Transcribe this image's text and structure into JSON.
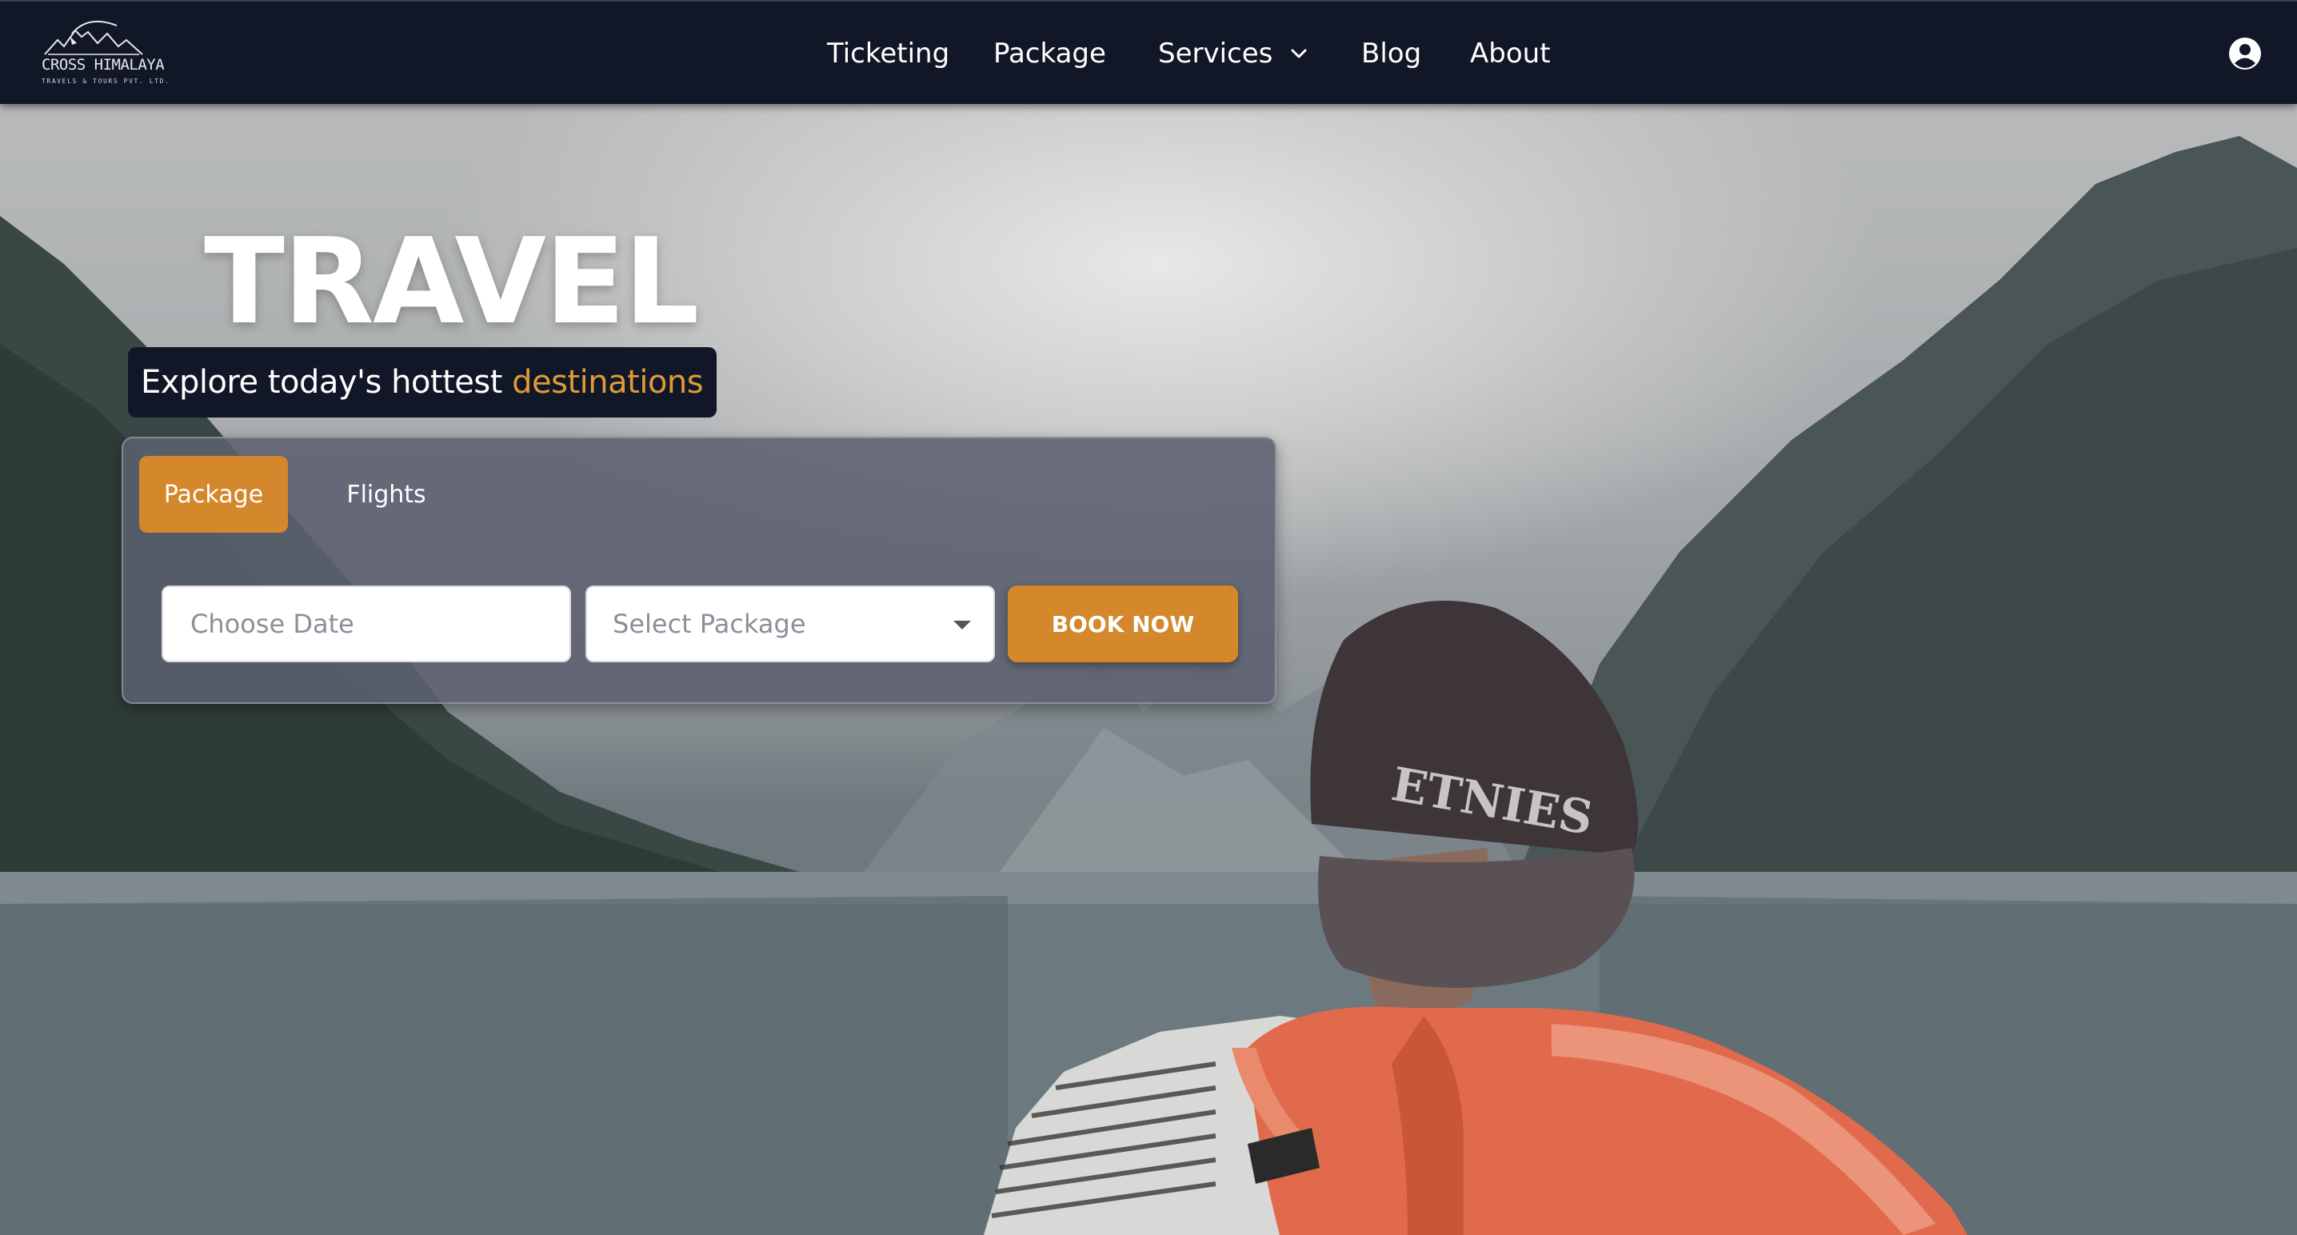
{
  "brand": {
    "name": "CROSS HIMALAYA",
    "subtitle": "TRAVELS & TOURS PVT. LTD."
  },
  "nav": {
    "items": [
      {
        "label": "Ticketing"
      },
      {
        "label": "Package"
      },
      {
        "label": "Services",
        "has_dropdown": true
      },
      {
        "label": "Blog"
      },
      {
        "label": "About"
      }
    ],
    "icons": [
      "chevron-down-icon",
      "user-account-icon"
    ]
  },
  "hero": {
    "headline": "TRAVEL",
    "tagline_prefix": "Explore today's hottest ",
    "tagline_accent": "destinations"
  },
  "booking": {
    "tabs": [
      {
        "label": "Package",
        "active": true
      },
      {
        "label": "Flights",
        "active": false
      }
    ],
    "date_placeholder": "Choose Date",
    "package_select": "Select Package",
    "submit_label": "BOOK NOW"
  },
  "colors": {
    "navbar_bg": "#111727",
    "accent": "#d4872b",
    "accent_text": "#e09a3a",
    "panel_bg": "#5c6070"
  }
}
